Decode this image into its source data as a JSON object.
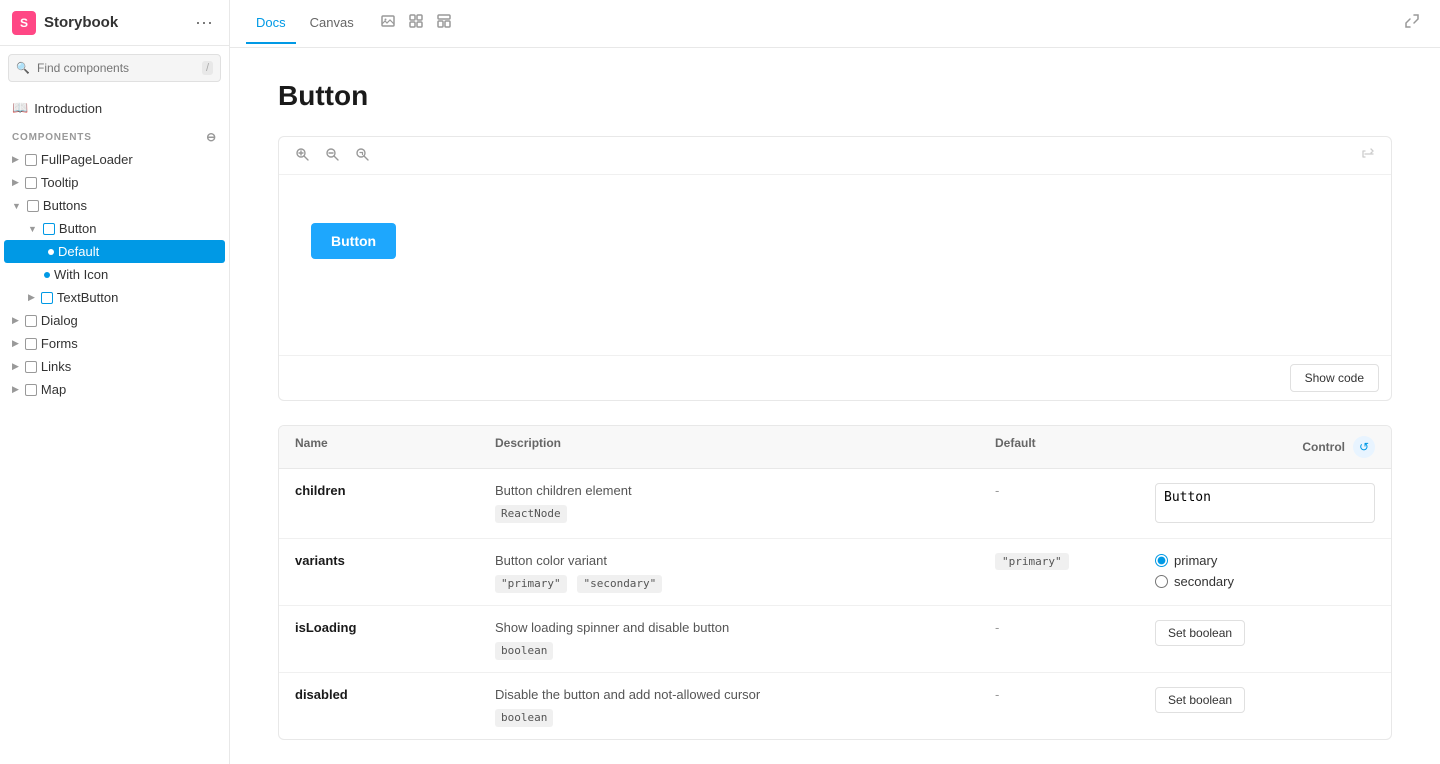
{
  "sidebar": {
    "brand": "Storybook",
    "search_placeholder": "Find components",
    "search_shortcut": "/",
    "intro_label": "Introduction",
    "components_label": "COMPONENTS",
    "items": [
      {
        "id": "full-page-loader",
        "label": "FullPageLoader",
        "indent": 0
      },
      {
        "id": "tooltip",
        "label": "Tooltip",
        "indent": 0
      },
      {
        "id": "buttons",
        "label": "Buttons",
        "indent": 0
      },
      {
        "id": "button",
        "label": "Button",
        "indent": 1
      },
      {
        "id": "default",
        "label": "Default",
        "indent": 2,
        "active": true
      },
      {
        "id": "with-icon",
        "label": "With Icon",
        "indent": 2
      },
      {
        "id": "text-button",
        "label": "TextButton",
        "indent": 1
      },
      {
        "id": "dialog",
        "label": "Dialog",
        "indent": 0
      },
      {
        "id": "forms",
        "label": "Forms",
        "indent": 0
      },
      {
        "id": "links",
        "label": "Links",
        "indent": 0
      },
      {
        "id": "map",
        "label": "Map",
        "indent": 0
      }
    ]
  },
  "topbar": {
    "tabs": [
      "Docs",
      "Canvas"
    ],
    "active_tab": "Docs"
  },
  "page": {
    "title": "Button"
  },
  "preview": {
    "button_label": "Button",
    "show_code_label": "Show code"
  },
  "props_table": {
    "columns": [
      "Name",
      "Description",
      "Default",
      "Control"
    ],
    "rows": [
      {
        "name": "children",
        "description": "Button children element",
        "type": "ReactNode",
        "default": "-",
        "control_type": "textarea",
        "control_value": "Button"
      },
      {
        "name": "variants",
        "description": "Button color variant",
        "types": [
          "\"primary\"",
          "\"secondary\""
        ],
        "default": "\"primary\"",
        "control_type": "radio",
        "options": [
          "primary",
          "secondary"
        ],
        "selected": "primary"
      },
      {
        "name": "isLoading",
        "description": "Show loading spinner and disable button",
        "type": "boolean",
        "default": "-",
        "control_type": "boolean",
        "control_label": "Set boolean"
      },
      {
        "name": "disabled",
        "description": "Disable the button and add not-allowed cursor",
        "type": "boolean",
        "default": "-",
        "control_type": "boolean",
        "control_label": "Set boolean"
      }
    ]
  }
}
